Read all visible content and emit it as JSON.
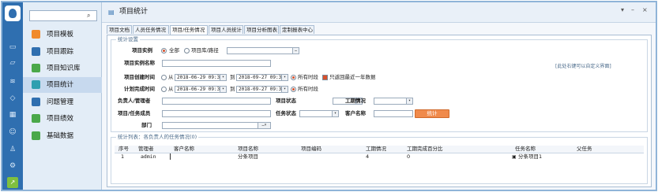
{
  "nav": {
    "search_placeholder": "",
    "items": [
      {
        "label": "项目模板",
        "icon": "template-icon",
        "color": "#f08a2b"
      },
      {
        "label": "项目跟踪",
        "icon": "tracking-icon",
        "color": "#2f6fb0"
      },
      {
        "label": "项目知识库",
        "icon": "knowledge-icon",
        "color": "#4aa84a"
      },
      {
        "label": "项目统计",
        "icon": "statistics-icon",
        "color": "#2f9fb0"
      },
      {
        "label": "问题管理",
        "icon": "issue-icon",
        "color": "#2f6fb0"
      },
      {
        "label": "项目绩效",
        "icon": "performance-icon",
        "color": "#4aa84a"
      },
      {
        "label": "基础数据",
        "icon": "basic-data-icon",
        "color": "#4aa84a"
      }
    ]
  },
  "header": {
    "title": "项目统计",
    "win_icons": [
      "▾",
      "–",
      "×"
    ]
  },
  "tabs": [
    "项目文档",
    "人员任务情况",
    "项目/任务情况",
    "项目人员统计",
    "项目分析图表",
    "定制报表中心"
  ],
  "settings": {
    "group_title": "统计设置",
    "hint": "[此处右键可以自定义界面]",
    "instance_label": "项目实例",
    "instance_all": "全部",
    "instance_lib": "项目库/路径",
    "instance_name_label": "项目实例名称",
    "created_label": "项目创建时间",
    "from": "从",
    "to": "到",
    "created_from": "2018-06-29 09:36",
    "created_to": "2018-09-27 09:36",
    "all_periods": "所有时段",
    "recent_year": "只返回最近一年数据",
    "planned_label": "计划完成时间",
    "planned_from": "2018-06-29 09:36",
    "planned_to": "2018-09-27 09:36",
    "owner_label": "负责人/管理者",
    "project_status_label": "项目状态",
    "workhours_label": "工期情况",
    "member_label": "项目/任务成员",
    "task_status_label": "任务状态",
    "customer_label": "客户名称",
    "dept_label": "部门",
    "stat_button": "统计"
  },
  "results": {
    "group_title": "统计列表：各负责人的任务情况(0)",
    "columns": [
      "序号",
      "管理者",
      "客户名称",
      "项目名称",
      "项目编码",
      "工期情况",
      "工期完成百分比",
      "任务名称",
      "父任务"
    ],
    "rows": [
      {
        "no": "1",
        "manager": "admin",
        "customer": "",
        "project": "分条项目",
        "code": "",
        "duration": "4",
        "percent": "0",
        "task": "分条项目1",
        "parent": ""
      }
    ]
  }
}
